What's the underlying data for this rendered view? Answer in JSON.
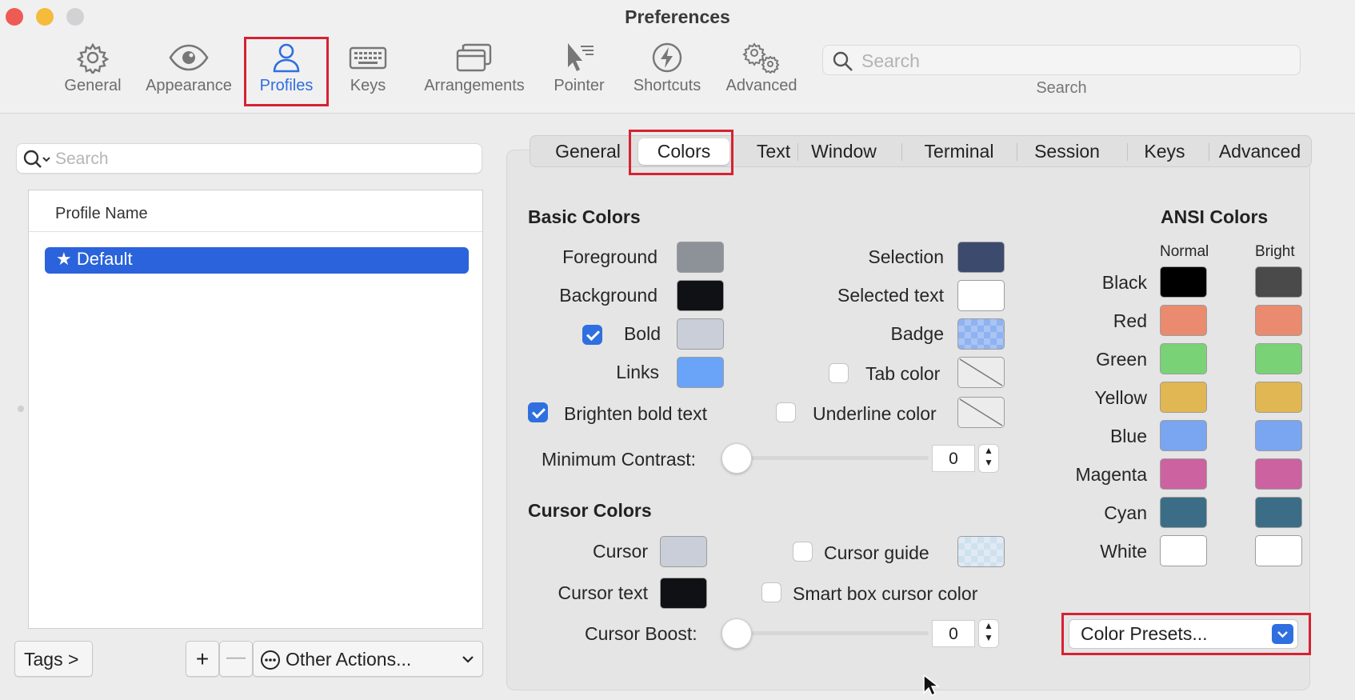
{
  "window": {
    "title": "Preferences"
  },
  "toolbar": {
    "items": [
      {
        "label": "General"
      },
      {
        "label": "Appearance"
      },
      {
        "label": "Profiles"
      },
      {
        "label": "Keys"
      },
      {
        "label": "Arrangements"
      },
      {
        "label": "Pointer"
      },
      {
        "label": "Shortcuts"
      },
      {
        "label": "Advanced"
      }
    ],
    "active": "Profiles",
    "search_placeholder": "Search",
    "search_label": "Search"
  },
  "profiles": {
    "search_placeholder": "Search",
    "column_header": "Profile Name",
    "items": [
      {
        "name": "Default",
        "starred": true
      }
    ],
    "tags_button": "Tags >",
    "add_button": "+",
    "remove_button": "—",
    "other_actions": "Other Actions..."
  },
  "tabs": {
    "items": [
      "General",
      "Colors",
      "Text",
      "Window",
      "Terminal",
      "Session",
      "Keys",
      "Advanced"
    ],
    "active": "Colors"
  },
  "basic_colors": {
    "heading": "Basic Colors",
    "foreground": {
      "label": "Foreground",
      "color": "#8d9299"
    },
    "background": {
      "label": "Background",
      "color": "#101114"
    },
    "bold": {
      "label": "Bold",
      "checked": true,
      "color": "#c9ced8"
    },
    "links": {
      "label": "Links",
      "color": "#6aa4f8"
    },
    "selection": {
      "label": "Selection",
      "color": "#3c4b6d"
    },
    "selected_text": {
      "label": "Selected text",
      "color": "#ffffff"
    },
    "badge": {
      "label": "Badge",
      "color": "#8fb2f0"
    },
    "tab_color": {
      "label": "Tab color",
      "checked": false
    },
    "underline_color": {
      "label": "Underline color",
      "checked": false
    },
    "brighten_bold": {
      "label": "Brighten bold text",
      "checked": true
    },
    "min_contrast": {
      "label": "Minimum Contrast:",
      "value": "0"
    }
  },
  "cursor_colors": {
    "heading": "Cursor Colors",
    "cursor": {
      "label": "Cursor",
      "color": "#c9ced8"
    },
    "cursor_text": {
      "label": "Cursor text",
      "color": "#101114"
    },
    "cursor_guide": {
      "label": "Cursor guide",
      "checked": false,
      "color": "#dfeaf4"
    },
    "smart_box": {
      "label": "Smart box cursor color",
      "checked": false
    },
    "cursor_boost": {
      "label": "Cursor Boost:",
      "value": "0"
    }
  },
  "ansi": {
    "heading": "ANSI Colors",
    "normal_label": "Normal",
    "bright_label": "Bright",
    "rows": [
      {
        "name": "Black",
        "normal": "#000000",
        "bright": "#4a4a4a"
      },
      {
        "name": "Red",
        "normal": "#ea8a6e",
        "bright": "#ea8a6e"
      },
      {
        "name": "Green",
        "normal": "#7ad276",
        "bright": "#7ad276"
      },
      {
        "name": "Yellow",
        "normal": "#e1b753",
        "bright": "#e1b753"
      },
      {
        "name": "Blue",
        "normal": "#7aa5f0",
        "bright": "#7aa5f0"
      },
      {
        "name": "Magenta",
        "normal": "#cc629f",
        "bright": "#cc629f"
      },
      {
        "name": "Cyan",
        "normal": "#3b6e86",
        "bright": "#3b6e86"
      },
      {
        "name": "White",
        "normal": "#ffffff",
        "bright": "#ffffff"
      }
    ]
  },
  "color_presets": {
    "label": "Color Presets..."
  },
  "accent_color": "#2f6fe0",
  "highlight_color": "#d62232"
}
